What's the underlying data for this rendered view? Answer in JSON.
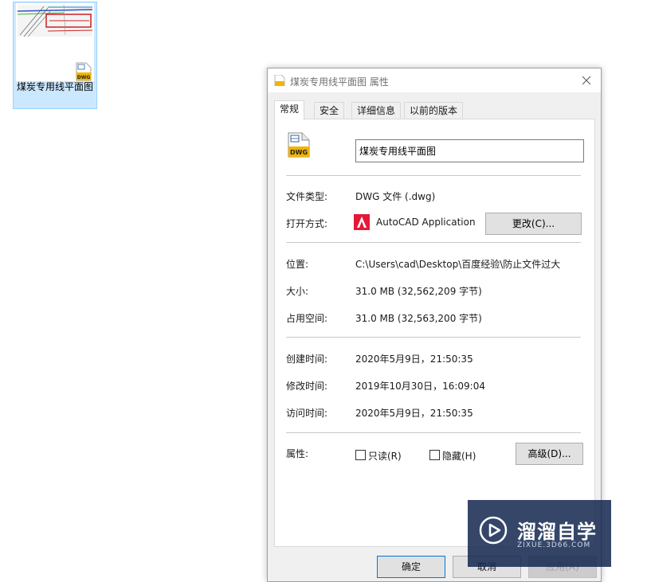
{
  "desktop": {
    "file_label": "煤炭专用线平面图",
    "thumb_badge": "DWG"
  },
  "dialog": {
    "title": "煤炭专用线平面图 属性",
    "tabs": [
      {
        "label": "常规",
        "active": true
      },
      {
        "label": "安全",
        "active": false
      },
      {
        "label": "详细信息",
        "active": false
      },
      {
        "label": "以前的版本",
        "active": false
      }
    ],
    "file_icon_badge": "DWG",
    "name_value": "煤炭专用线平面图",
    "file_type": {
      "label": "文件类型:",
      "value": "DWG 文件 (.dwg)"
    },
    "open_with": {
      "label": "打开方式:",
      "value": "AutoCAD Application",
      "change_button": "更改(C)..."
    },
    "location": {
      "label": "位置:",
      "value": "C:\\Users\\cad\\Desktop\\百度经验\\防止文件过大"
    },
    "size": {
      "label": "大小:",
      "value": "31.0 MB (32,562,209 字节)"
    },
    "size_on_disk": {
      "label": "占用空间:",
      "value": "31.0 MB (32,563,200 字节)"
    },
    "created": {
      "label": "创建时间:",
      "value": "2020年5月9日，21:50:35"
    },
    "modified": {
      "label": "修改时间:",
      "value": "2019年10月30日，16:09:04"
    },
    "accessed": {
      "label": "访问时间:",
      "value": "2020年5月9日，21:50:35"
    },
    "attributes": {
      "label": "属性:",
      "readonly": {
        "label": "只读(R)",
        "checked": false
      },
      "hidden": {
        "label": "隐藏(H)",
        "checked": false
      },
      "advanced_button": "高级(D)..."
    },
    "footer": {
      "ok": "确定",
      "cancel": "取消",
      "apply": "应用(A)"
    }
  },
  "watermark": {
    "title": "溜溜自学",
    "subtitle": "ZIXUE.3D66.COM"
  },
  "colors": {
    "accent": "#0078d7",
    "dwg_yellow": "#f2b400",
    "autocad_red": "#e51937",
    "watermark_bg": "#142850"
  }
}
